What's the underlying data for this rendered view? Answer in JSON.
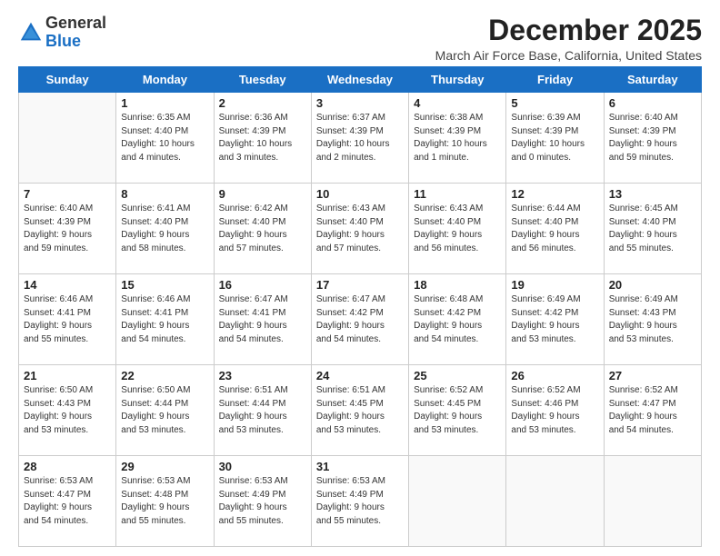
{
  "logo": {
    "general": "General",
    "blue": "Blue"
  },
  "title": "December 2025",
  "subtitle": "March Air Force Base, California, United States",
  "days_header": [
    "Sunday",
    "Monday",
    "Tuesday",
    "Wednesday",
    "Thursday",
    "Friday",
    "Saturday"
  ],
  "weeks": [
    [
      {
        "day": "",
        "info": ""
      },
      {
        "day": "1",
        "info": "Sunrise: 6:35 AM\nSunset: 4:40 PM\nDaylight: 10 hours\nand 4 minutes."
      },
      {
        "day": "2",
        "info": "Sunrise: 6:36 AM\nSunset: 4:39 PM\nDaylight: 10 hours\nand 3 minutes."
      },
      {
        "day": "3",
        "info": "Sunrise: 6:37 AM\nSunset: 4:39 PM\nDaylight: 10 hours\nand 2 minutes."
      },
      {
        "day": "4",
        "info": "Sunrise: 6:38 AM\nSunset: 4:39 PM\nDaylight: 10 hours\nand 1 minute."
      },
      {
        "day": "5",
        "info": "Sunrise: 6:39 AM\nSunset: 4:39 PM\nDaylight: 10 hours\nand 0 minutes."
      },
      {
        "day": "6",
        "info": "Sunrise: 6:40 AM\nSunset: 4:39 PM\nDaylight: 9 hours\nand 59 minutes."
      }
    ],
    [
      {
        "day": "7",
        "info": "Sunrise: 6:40 AM\nSunset: 4:39 PM\nDaylight: 9 hours\nand 59 minutes."
      },
      {
        "day": "8",
        "info": "Sunrise: 6:41 AM\nSunset: 4:40 PM\nDaylight: 9 hours\nand 58 minutes."
      },
      {
        "day": "9",
        "info": "Sunrise: 6:42 AM\nSunset: 4:40 PM\nDaylight: 9 hours\nand 57 minutes."
      },
      {
        "day": "10",
        "info": "Sunrise: 6:43 AM\nSunset: 4:40 PM\nDaylight: 9 hours\nand 57 minutes."
      },
      {
        "day": "11",
        "info": "Sunrise: 6:43 AM\nSunset: 4:40 PM\nDaylight: 9 hours\nand 56 minutes."
      },
      {
        "day": "12",
        "info": "Sunrise: 6:44 AM\nSunset: 4:40 PM\nDaylight: 9 hours\nand 56 minutes."
      },
      {
        "day": "13",
        "info": "Sunrise: 6:45 AM\nSunset: 4:40 PM\nDaylight: 9 hours\nand 55 minutes."
      }
    ],
    [
      {
        "day": "14",
        "info": "Sunrise: 6:46 AM\nSunset: 4:41 PM\nDaylight: 9 hours\nand 55 minutes."
      },
      {
        "day": "15",
        "info": "Sunrise: 6:46 AM\nSunset: 4:41 PM\nDaylight: 9 hours\nand 54 minutes."
      },
      {
        "day": "16",
        "info": "Sunrise: 6:47 AM\nSunset: 4:41 PM\nDaylight: 9 hours\nand 54 minutes."
      },
      {
        "day": "17",
        "info": "Sunrise: 6:47 AM\nSunset: 4:42 PM\nDaylight: 9 hours\nand 54 minutes."
      },
      {
        "day": "18",
        "info": "Sunrise: 6:48 AM\nSunset: 4:42 PM\nDaylight: 9 hours\nand 54 minutes."
      },
      {
        "day": "19",
        "info": "Sunrise: 6:49 AM\nSunset: 4:42 PM\nDaylight: 9 hours\nand 53 minutes."
      },
      {
        "day": "20",
        "info": "Sunrise: 6:49 AM\nSunset: 4:43 PM\nDaylight: 9 hours\nand 53 minutes."
      }
    ],
    [
      {
        "day": "21",
        "info": "Sunrise: 6:50 AM\nSunset: 4:43 PM\nDaylight: 9 hours\nand 53 minutes."
      },
      {
        "day": "22",
        "info": "Sunrise: 6:50 AM\nSunset: 4:44 PM\nDaylight: 9 hours\nand 53 minutes."
      },
      {
        "day": "23",
        "info": "Sunrise: 6:51 AM\nSunset: 4:44 PM\nDaylight: 9 hours\nand 53 minutes."
      },
      {
        "day": "24",
        "info": "Sunrise: 6:51 AM\nSunset: 4:45 PM\nDaylight: 9 hours\nand 53 minutes."
      },
      {
        "day": "25",
        "info": "Sunrise: 6:52 AM\nSunset: 4:45 PM\nDaylight: 9 hours\nand 53 minutes."
      },
      {
        "day": "26",
        "info": "Sunrise: 6:52 AM\nSunset: 4:46 PM\nDaylight: 9 hours\nand 53 minutes."
      },
      {
        "day": "27",
        "info": "Sunrise: 6:52 AM\nSunset: 4:47 PM\nDaylight: 9 hours\nand 54 minutes."
      }
    ],
    [
      {
        "day": "28",
        "info": "Sunrise: 6:53 AM\nSunset: 4:47 PM\nDaylight: 9 hours\nand 54 minutes."
      },
      {
        "day": "29",
        "info": "Sunrise: 6:53 AM\nSunset: 4:48 PM\nDaylight: 9 hours\nand 55 minutes."
      },
      {
        "day": "30",
        "info": "Sunrise: 6:53 AM\nSunset: 4:49 PM\nDaylight: 9 hours\nand 55 minutes."
      },
      {
        "day": "31",
        "info": "Sunrise: 6:53 AM\nSunset: 4:49 PM\nDaylight: 9 hours\nand 55 minutes."
      },
      {
        "day": "",
        "info": ""
      },
      {
        "day": "",
        "info": ""
      },
      {
        "day": "",
        "info": ""
      }
    ]
  ]
}
